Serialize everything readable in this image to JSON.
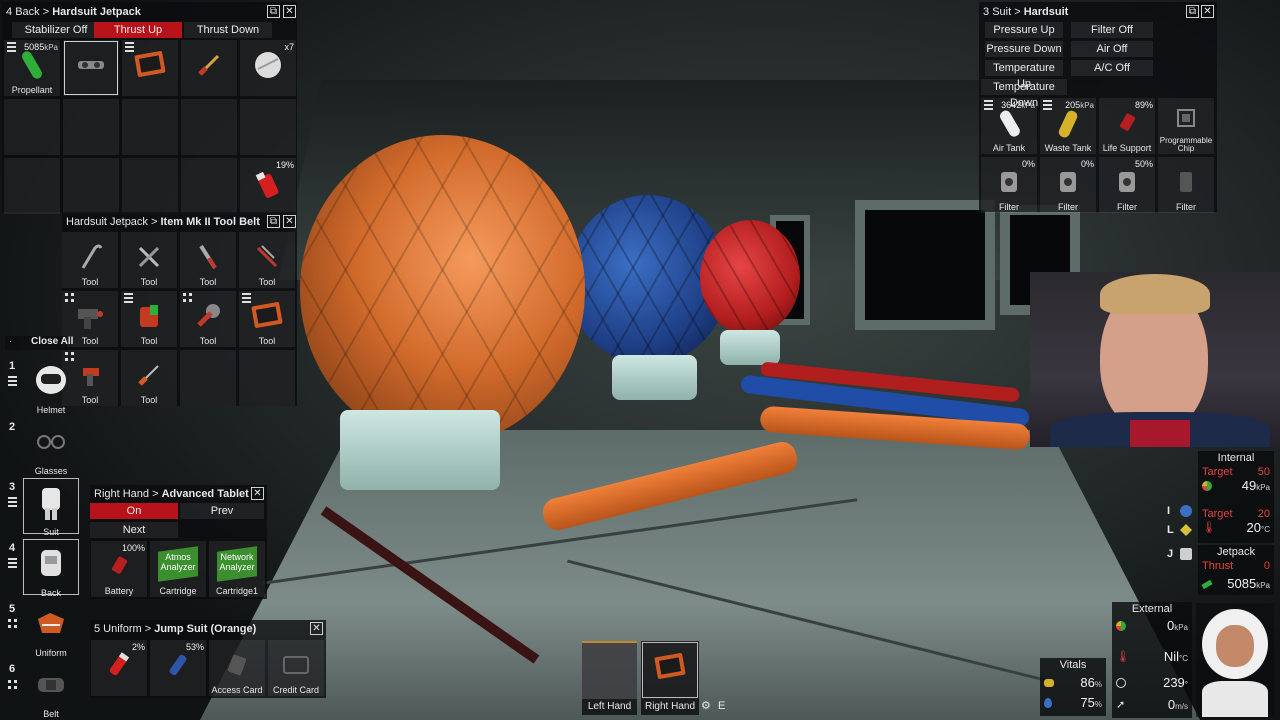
{
  "jetpack_panel": {
    "index": "4",
    "title_prefix": "Back > ",
    "title": "Hardsuit Jetpack",
    "buttons": [
      "Stabilizer Off",
      "Thrust Up",
      "Thrust Down"
    ],
    "slots": [
      {
        "label": "Propellant",
        "value": "5085",
        "unit": "kPa"
      },
      {
        "label": "",
        "value": ""
      },
      {
        "label": "",
        "value": ""
      },
      {
        "label": "",
        "value": ""
      },
      {
        "label": "",
        "value": "x7"
      }
    ],
    "last_slot_value": "19%"
  },
  "toolbelt_panel": {
    "title_prefix": "Hardsuit Jetpack > ",
    "title": "Item Mk II Tool Belt",
    "slots": [
      "Tool",
      "Tool",
      "Tool",
      "Tool",
      "Tool",
      "Tool",
      "Tool",
      "Tool",
      "Tool",
      "Tool"
    ]
  },
  "suit_panel": {
    "index": "3",
    "title_prefix": "Suit > ",
    "title": "Hardsuit",
    "buttons": [
      "Pressure Up",
      "Filter Off",
      "Pressure Down",
      "Air Off",
      "Temperature Up",
      "A/C Off",
      "Temperature Down"
    ],
    "slots": [
      {
        "label": "Air Tank",
        "value": "3642",
        "unit": "kPa"
      },
      {
        "label": "Waste Tank",
        "value": "205",
        "unit": "kPa"
      },
      {
        "label": "Life Support",
        "value": "89%"
      },
      {
        "label": "Programmable Chip",
        "value": ""
      },
      {
        "label": "Filter",
        "value": "0%"
      },
      {
        "label": "Filter",
        "value": "0%"
      },
      {
        "label": "Filter",
        "value": "50%"
      },
      {
        "label": "Filter",
        "value": ""
      }
    ]
  },
  "close_all_label": "Close All",
  "equipment": [
    {
      "num": "1",
      "label": "Helmet"
    },
    {
      "num": "2",
      "label": "Glasses"
    },
    {
      "num": "3",
      "label": "Suit"
    },
    {
      "num": "4",
      "label": "Back"
    },
    {
      "num": "5",
      "label": "Uniform"
    },
    {
      "num": "6",
      "label": "Belt"
    }
  ],
  "tablet_panel": {
    "title_prefix": "Right Hand > ",
    "title": "Advanced Tablet",
    "buttons": [
      "On",
      "Prev",
      "Next"
    ],
    "slots": [
      {
        "label": "Battery",
        "value": "100%",
        "text": ""
      },
      {
        "label": "Cartridge",
        "value": "",
        "text": "Atmos Analyzer"
      },
      {
        "label": "Cartridge1",
        "value": "",
        "text": "Network Analyzer"
      }
    ]
  },
  "uniform_panel": {
    "title_prefix": "5 Uniform > ",
    "title": "Jump Suit (Orange)",
    "slots": [
      {
        "label": "",
        "value": "2%"
      },
      {
        "label": "",
        "value": "53%"
      },
      {
        "label": "Access Card",
        "value": ""
      },
      {
        "label": "Credit Card",
        "value": ""
      }
    ]
  },
  "hands": {
    "left": "Left Hand",
    "right": "Right Hand",
    "swap_key": "E"
  },
  "internal": {
    "header": "Internal",
    "target1_label": "Target",
    "target1_value": "50",
    "pressure": "49",
    "pressure_unit": "kPa",
    "target2_label": "Target",
    "target2_value": "20",
    "temperature": "20",
    "temperature_unit": "°C",
    "side_keys": [
      "I",
      "L",
      "J"
    ]
  },
  "jetpack_hud": {
    "header": "Jetpack",
    "thrust_label": "Thrust",
    "thrust_value": "0",
    "pressure": "5085",
    "unit": "kPa"
  },
  "external": {
    "header": "External",
    "pressure": "0",
    "pressure_unit": "kPa",
    "temperature": "Nil",
    "temperature_unit": "°C",
    "direction": "239",
    "direction_unit": "°",
    "speed": "0",
    "speed_unit": "m/s"
  },
  "vitals": {
    "header": "Vitals",
    "food": "86",
    "water": "75",
    "unit": "%"
  },
  "colors": {
    "accent_red": "#b8131a",
    "target_red": "#e64141"
  }
}
